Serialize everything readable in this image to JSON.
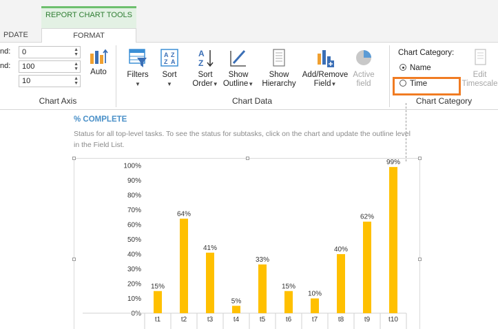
{
  "tabs": {
    "context_title": "REPORT CHART TOOLS",
    "update": "PDATE",
    "format": "FORMAT"
  },
  "axis": {
    "row1_label": "nd:",
    "row1_value": "0",
    "row2_label": "nd:",
    "row2_value": "100",
    "row3_value": "10",
    "auto_label": "Auto",
    "group_label": "Chart Axis"
  },
  "chart_data_group": {
    "filters": "Filters",
    "sort": "Sort",
    "sort_order_1": "Sort",
    "sort_order_2": "Order",
    "show_outline_1": "Show",
    "show_outline_2": "Outline",
    "show_hierarchy_1": "Show",
    "show_hierarchy_2": "Hierarchy",
    "add_remove_1": "Add/Remove",
    "add_remove_2": "Field",
    "active_field_1": "Active",
    "active_field_2": "field",
    "group_label": "Chart Data"
  },
  "chart_category_group": {
    "heading": "Chart Category:",
    "option_name": "Name",
    "option_time": "Time",
    "edit_timescale_1": "Edit",
    "edit_timescale_2": "Timescale",
    "group_label": "Chart Category"
  },
  "report": {
    "title": "% COMPLETE",
    "description": "Status for all top-level tasks. To see the status for subtasks, click on the chart and update the outline level in the Field List."
  },
  "colors": {
    "bar": "#ffc000",
    "accent": "#f07b22",
    "title": "#4a90c8"
  },
  "chart_data": {
    "type": "bar",
    "categories": [
      "t1",
      "t2",
      "t3",
      "t4",
      "t5",
      "t6",
      "t7",
      "t8",
      "t9",
      "t10"
    ],
    "values": [
      15,
      64,
      41,
      5,
      33,
      15,
      10,
      40,
      62,
      99
    ],
    "data_labels": [
      "15%",
      "64%",
      "41%",
      "5%",
      "33%",
      "15%",
      "10%",
      "40%",
      "62%",
      "99%"
    ],
    "ylim": [
      0,
      100
    ],
    "y_ticks": [
      "0%",
      "10%",
      "20%",
      "30%",
      "40%",
      "50%",
      "60%",
      "70%",
      "80%",
      "90%",
      "100%"
    ],
    "grid": false,
    "legend": false
  }
}
